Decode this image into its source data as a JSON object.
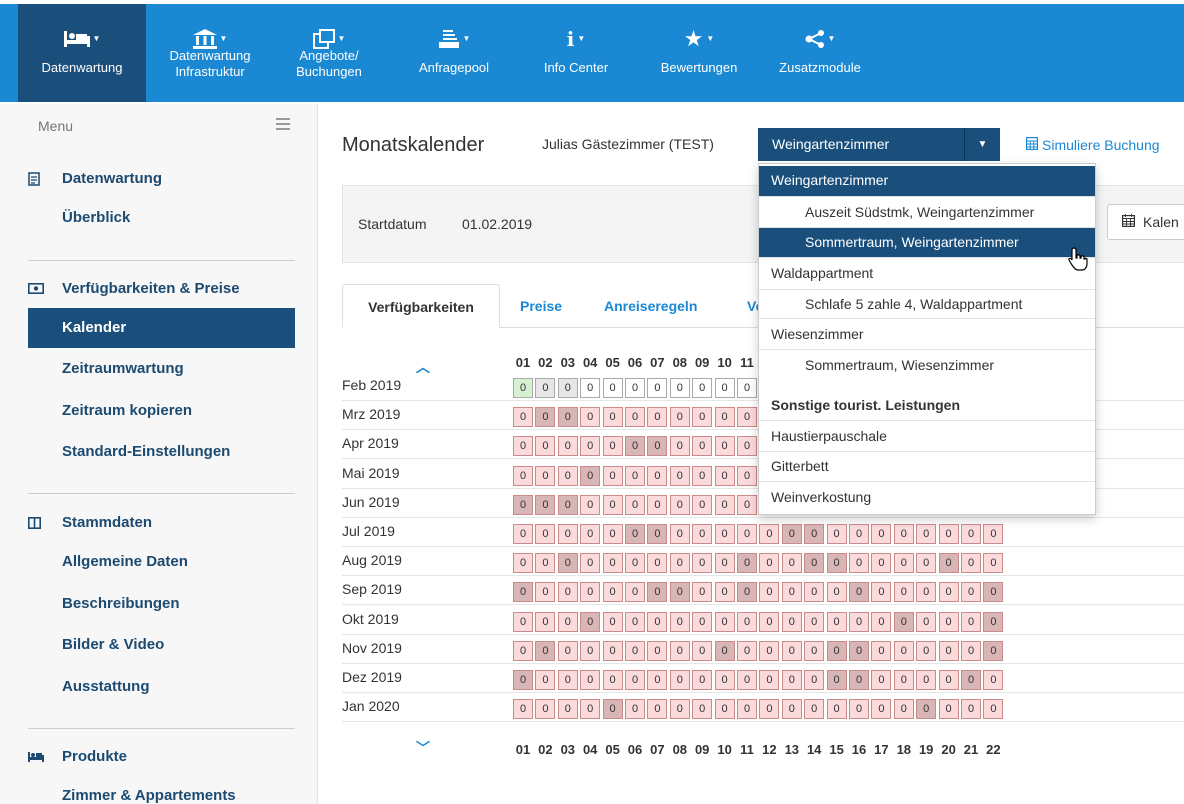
{
  "nav": {
    "items": [
      {
        "label1": "Datenwartung",
        "label2": "",
        "icon": "bed-icon",
        "active": true
      },
      {
        "label1": "Datenwartung",
        "label2": "Infrastruktur",
        "icon": "bank-icon",
        "active": false
      },
      {
        "label1": "Angebote/",
        "label2": "Buchungen",
        "icon": "offers-icon",
        "active": false
      },
      {
        "label1": "Anfragepool",
        "label2": "",
        "icon": "inbox-icon",
        "active": false
      },
      {
        "label1": "Info Center",
        "label2": "",
        "icon": "info-icon",
        "active": false
      },
      {
        "label1": "Bewertungen",
        "label2": "",
        "icon": "star-icon",
        "active": false
      },
      {
        "label1": "Zusatzmodule",
        "label2": "",
        "icon": "share-icon",
        "active": false
      }
    ]
  },
  "sidebar": {
    "menu_label": "Menu",
    "sections": [
      {
        "title": "Datenwartung",
        "icon": "document-icon",
        "links": [
          "Überblick"
        ]
      },
      {
        "title": "Verfügbarkeiten & Preise",
        "icon": "money-icon",
        "links": [
          "Kalender",
          "Zeitraumwartung",
          "Zeitraum kopieren",
          "Standard-Einstellungen"
        ]
      },
      {
        "title": "Stammdaten",
        "icon": "columns-icon",
        "links": [
          "Allgemeine Daten",
          "Beschreibungen",
          "Bilder & Video",
          "Ausstattung"
        ]
      },
      {
        "title": "Produkte",
        "icon": "bed-icon",
        "links": [
          "Zimmer & Appartements"
        ]
      }
    ]
  },
  "main": {
    "title": "Monatskalender",
    "property": "Julias Gästezimmer (TEST)",
    "select_value": "Weingartenzimmer",
    "simulate_link": "Simuliere Buchung",
    "start_label": "Startdatum",
    "start_value": "01.02.2019",
    "calendar_button": "Kalen",
    "tabs": [
      "Verfügbarkeiten",
      "Preise",
      "Anreiseregeln",
      "Ve"
    ]
  },
  "dropdown": {
    "options": [
      {
        "label": "Weingartenzimmer",
        "kind": "group",
        "selected": true
      },
      {
        "label": "Auszeit Südstmk, Weingartenzimmer",
        "kind": "sub",
        "selected": false
      },
      {
        "label": "Sommertraum, Weingartenzimmer",
        "kind": "sub",
        "selected": true
      },
      {
        "label": "Waldappartment",
        "kind": "group",
        "selected": false
      },
      {
        "label": "Schlafe 5 zahle 4, Waldappartment",
        "kind": "sub",
        "selected": false
      },
      {
        "label": "Wiesenzimmer",
        "kind": "group",
        "selected": false
      },
      {
        "label": "Sommertraum, Wiesenzimmer",
        "kind": "sub",
        "selected": false
      },
      {
        "label": "Sonstige tourist. Leistungen",
        "kind": "header",
        "selected": false
      },
      {
        "label": "Haustierpauschale",
        "kind": "group",
        "selected": false
      },
      {
        "label": "Gitterbett",
        "kind": "group",
        "selected": false
      },
      {
        "label": "Weinverkostung",
        "kind": "group",
        "selected": false
      }
    ]
  },
  "calendar": {
    "days": [
      "01",
      "02",
      "03",
      "04",
      "05",
      "06",
      "07",
      "08",
      "09",
      "10",
      "11",
      "12",
      "13",
      "14",
      "15",
      "16",
      "17",
      "18",
      "19",
      "20",
      "21",
      "22"
    ],
    "cell_value": "0",
    "months": [
      {
        "label": "Feb 2019",
        "cells": "nggwwwwwwwwwwwwwwwwpgp"
      },
      {
        "label": "Mrz 2019",
        "cells": "pggpppppppppppppppppgp"
      },
      {
        "label": "Apr 2019",
        "cells": "pppppggpppppppppppppgp"
      },
      {
        "label": "Mai 2019",
        "cells": "pppgpppppppppppppppppp"
      },
      {
        "label": "Jun 2019",
        "cells": "gggpppppppppppppppppgp"
      },
      {
        "label": "Jul 2019",
        "cells": "pppppggpppppggpppppppp"
      },
      {
        "label": "Aug 2019",
        "cells": "ppgpppppppgppggppppgpp"
      },
      {
        "label": "Sep 2019",
        "cells": "gpppppggppgppppgpppppg"
      },
      {
        "label": "Okt 2019",
        "cells": "pppgpppppppppppppgpppg"
      },
      {
        "label": "Nov 2019",
        "cells": "pgpppppppgppppggpppppg"
      },
      {
        "label": "Dez 2019",
        "cells": "gpppppppppppppggppppgp"
      },
      {
        "label": "Jan 2020",
        "cells": "ppppgpppppppppppppgppp"
      }
    ]
  },
  "colors": {
    "nav_bg": "#1a88d3",
    "nav_active": "#1a4f7c",
    "available": "#fadada",
    "booked": "#d9b6b6",
    "link": "#1a88d3"
  }
}
